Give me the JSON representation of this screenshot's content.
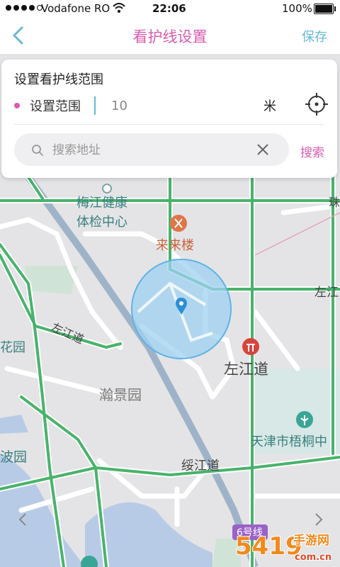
{
  "status_bar": {
    "carrier": "Vodafone RO",
    "time": "22:06",
    "battery": "100%"
  },
  "nav": {
    "title": "看护线设置",
    "save_label": "保存"
  },
  "range_card": {
    "title": "设置看护线范围",
    "range_label": "设置范围",
    "range_value": "10",
    "unit": "米",
    "search_placeholder": "搜索地址",
    "search_label": "搜索"
  },
  "map": {
    "labels": {
      "mei_jiang": "梅江健康",
      "health_center": "体检中心",
      "restaurant": "来来楼",
      "zuojiang_left": "左江道",
      "zuojiang_right": "左江",
      "zuojiang_main": "左江道",
      "hanjing": "瀚景园",
      "hua_yuan": "花园",
      "tianjin": "天津市梧桐中",
      "bo_yuan": "波园",
      "suijiang": "绥江道",
      "metro_line": "6号线",
      "edge_char": "珠"
    },
    "colors": {
      "road_green": "#48b36b",
      "circle_fill": "#9fd1f2",
      "accent_pink": "#d95bb0",
      "accent_blue": "#67b8d6"
    }
  },
  "watermark": {
    "text": "手游网",
    "number": "5419",
    "domain": "com.cn"
  }
}
